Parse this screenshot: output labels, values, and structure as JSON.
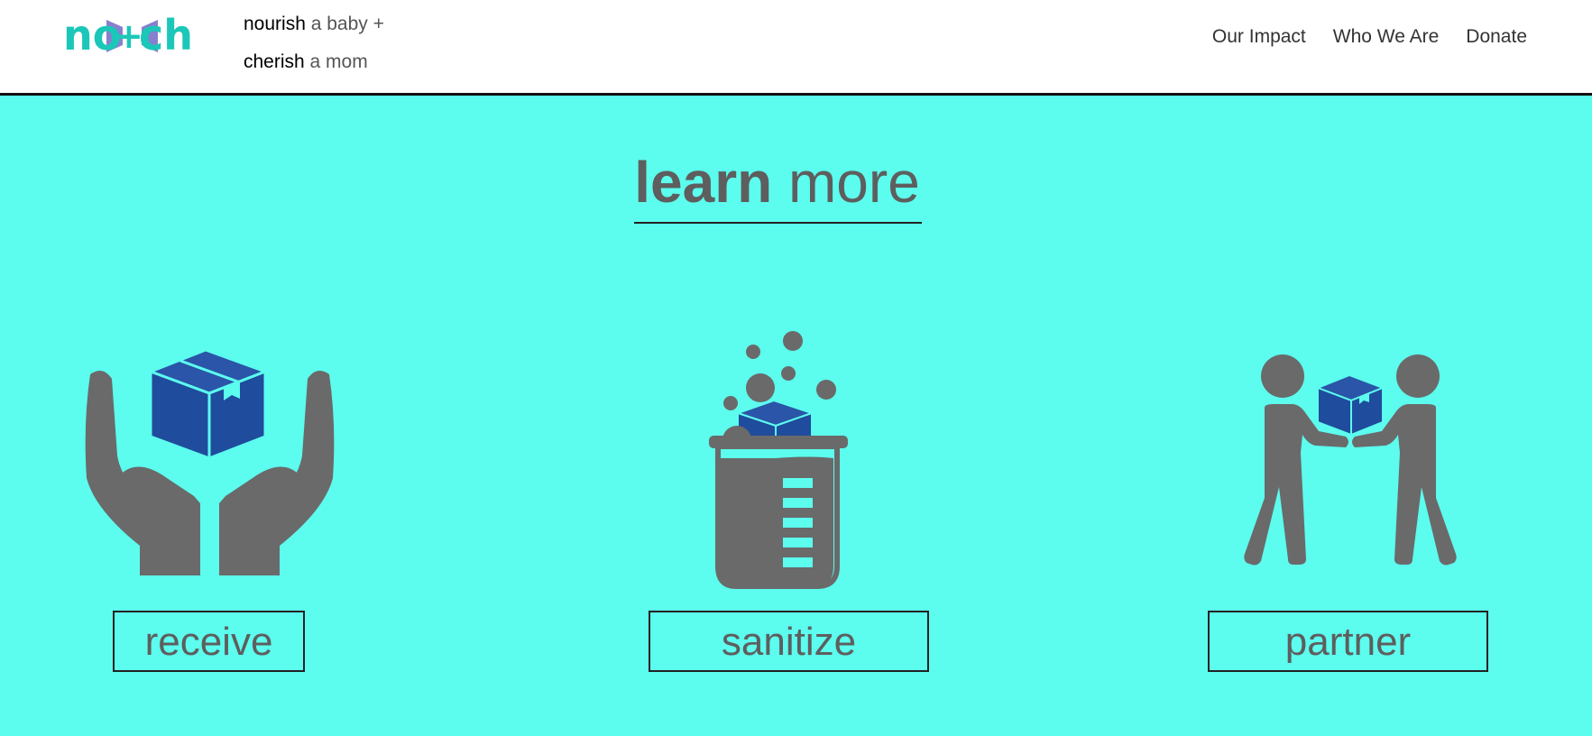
{
  "brand": {
    "logo_text": "no+ch",
    "logo_parts": [
      "no",
      "+",
      "ch"
    ],
    "tagline": [
      {
        "strong": "nourish",
        "rest": " a baby +"
      },
      {
        "strong": "cherish",
        "rest": " a mom"
      }
    ]
  },
  "nav": {
    "items": [
      {
        "label": "Our Impact"
      },
      {
        "label": "Who We Are"
      },
      {
        "label": "Donate"
      }
    ]
  },
  "section": {
    "title_bold": "learn",
    "title_rest": " more"
  },
  "features": [
    {
      "label": "receive",
      "icon": "hands-receiving-box-icon"
    },
    {
      "label": "sanitize",
      "icon": "beaker-sanitize-icon"
    },
    {
      "label": "partner",
      "icon": "people-handing-box-icon"
    }
  ],
  "colors": {
    "background": "#5cfcee",
    "logo_teal": "#1bc7b8",
    "logo_purple": "#7a72c9",
    "icon_gray": "#666666",
    "box_blue": "#1f4c9c",
    "text_gray": "#5e5e5e"
  }
}
